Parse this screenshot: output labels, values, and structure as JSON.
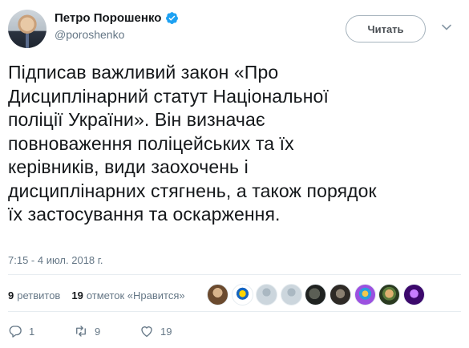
{
  "header": {
    "display_name": "Петро Порошенко",
    "handle": "@poroshenko",
    "follow_label": "Читать"
  },
  "tweet": {
    "text": "Підписав важливий закон «Про\nДисциплінарний статут Національної\nполіції України». Він визначає\nповноваження поліцейських та їх\nкерівників, види заохочень і\nдисциплінарних стягнень, а також порядок\nїх застосування та оскарження.",
    "timestamp": "7:15 - 4 июл. 2018 г."
  },
  "stats": {
    "retweets_count": "9",
    "retweets_label": "ретвитов",
    "likes_count": "19",
    "likes_label": "отметок «Нравится»"
  },
  "actions": {
    "reply_count": "1",
    "retweet_count": "9",
    "like_count": "19"
  },
  "colors": {
    "verified": "#1da1f2",
    "secondary_text": "#657786",
    "divider": "#e6ecf0"
  },
  "icons": [
    "verified-badge-icon",
    "chevron-down-icon",
    "reply-icon",
    "retweet-icon",
    "heart-icon"
  ]
}
